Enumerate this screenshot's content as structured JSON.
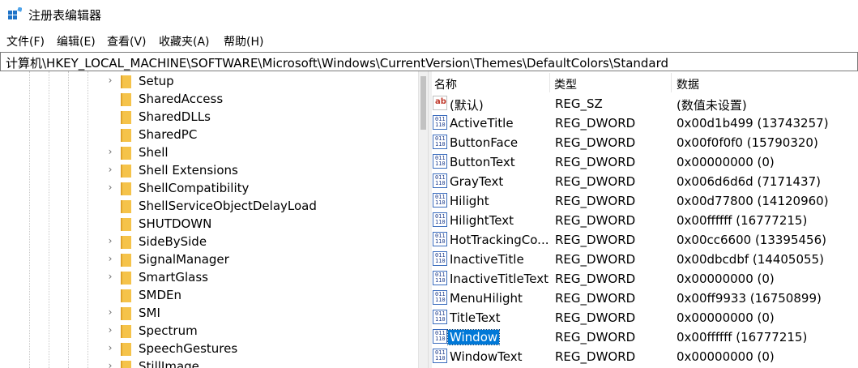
{
  "window": {
    "title": "注册表编辑器"
  },
  "menu": [
    {
      "label": "文件(F)"
    },
    {
      "label": "编辑(E)"
    },
    {
      "label": "查看(V)"
    },
    {
      "label": "收藏夹(A)"
    },
    {
      "label": "帮助(H)"
    }
  ],
  "address": {
    "path": "计算机\\HKEY_LOCAL_MACHINE\\SOFTWARE\\Microsoft\\Windows\\CurrentVersion\\Themes\\DefaultColors\\Standard"
  },
  "tree": {
    "items": [
      {
        "label": "Setup",
        "expandable": true
      },
      {
        "label": "SharedAccess",
        "expandable": false
      },
      {
        "label": "SharedDLLs",
        "expandable": false
      },
      {
        "label": "SharedPC",
        "expandable": false
      },
      {
        "label": "Shell",
        "expandable": true
      },
      {
        "label": "Shell Extensions",
        "expandable": true
      },
      {
        "label": "ShellCompatibility",
        "expandable": true
      },
      {
        "label": "ShellServiceObjectDelayLoad",
        "expandable": false
      },
      {
        "label": "SHUTDOWN",
        "expandable": false
      },
      {
        "label": "SideBySide",
        "expandable": true
      },
      {
        "label": "SignalManager",
        "expandable": true
      },
      {
        "label": "SmartGlass",
        "expandable": true
      },
      {
        "label": "SMDEn",
        "expandable": false
      },
      {
        "label": "SMI",
        "expandable": true
      },
      {
        "label": "Spectrum",
        "expandable": true
      },
      {
        "label": "SpeechGestures",
        "expandable": true
      },
      {
        "label": "StillImage",
        "expandable": true
      }
    ]
  },
  "list": {
    "columns": {
      "name": "名称",
      "type": "类型",
      "data": "数据"
    },
    "rows": [
      {
        "name": "(默认)",
        "type": "REG_SZ",
        "data": "(数值未设置)",
        "icon": "string-value-icon",
        "selected": false
      },
      {
        "name": "ActiveTitle",
        "type": "REG_DWORD",
        "data": "0x00d1b499 (13743257)",
        "icon": "binary-value-icon",
        "selected": false
      },
      {
        "name": "ButtonFace",
        "type": "REG_DWORD",
        "data": "0x00f0f0f0 (15790320)",
        "icon": "binary-value-icon",
        "selected": false
      },
      {
        "name": "ButtonText",
        "type": "REG_DWORD",
        "data": "0x00000000 (0)",
        "icon": "binary-value-icon",
        "selected": false
      },
      {
        "name": "GrayText",
        "type": "REG_DWORD",
        "data": "0x006d6d6d (7171437)",
        "icon": "binary-value-icon",
        "selected": false
      },
      {
        "name": "Hilight",
        "type": "REG_DWORD",
        "data": "0x00d77800 (14120960)",
        "icon": "binary-value-icon",
        "selected": false
      },
      {
        "name": "HilightText",
        "type": "REG_DWORD",
        "data": "0x00ffffff (16777215)",
        "icon": "binary-value-icon",
        "selected": false
      },
      {
        "name": "HotTrackingCo...",
        "type": "REG_DWORD",
        "data": "0x00cc6600 (13395456)",
        "icon": "binary-value-icon",
        "selected": false
      },
      {
        "name": "InactiveTitle",
        "type": "REG_DWORD",
        "data": "0x00dbcdbf (14405055)",
        "icon": "binary-value-icon",
        "selected": false
      },
      {
        "name": "InactiveTitleText",
        "type": "REG_DWORD",
        "data": "0x00000000 (0)",
        "icon": "binary-value-icon",
        "selected": false
      },
      {
        "name": "MenuHilight",
        "type": "REG_DWORD",
        "data": "0x00ff9933 (16750899)",
        "icon": "binary-value-icon",
        "selected": false
      },
      {
        "name": "TitleText",
        "type": "REG_DWORD",
        "data": "0x00000000 (0)",
        "icon": "binary-value-icon",
        "selected": false
      },
      {
        "name": "Window",
        "type": "REG_DWORD",
        "data": "0x00ffffff (16777215)",
        "icon": "binary-value-icon",
        "selected": true
      },
      {
        "name": "WindowText",
        "type": "REG_DWORD",
        "data": "0x00000000 (0)",
        "icon": "binary-value-icon",
        "selected": false
      }
    ]
  },
  "colors": {
    "selection": "#0078d7",
    "folder": "#f5c34a"
  }
}
